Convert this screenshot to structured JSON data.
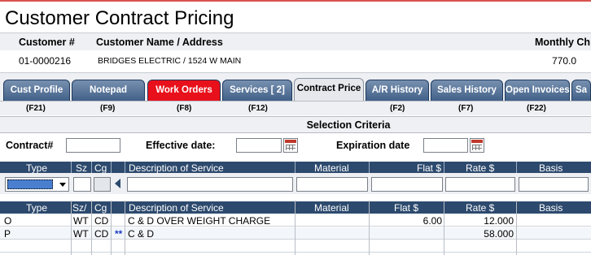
{
  "title": "Customer Contract Pricing",
  "customer": {
    "num_header": "Customer #",
    "name_header": "Customer Name / Address",
    "monthly_header": "Monthly Ch",
    "num": "01-0000216",
    "name_address": "BRIDGES ELECTRIC  /  1524 W MAIN",
    "monthly": "770.0"
  },
  "tabs": [
    {
      "label": "Cust Profile",
      "fkey": "(F21)"
    },
    {
      "label": "Notepad",
      "fkey": "(F9)"
    },
    {
      "label": "Work Orders",
      "fkey": "(F8)"
    },
    {
      "label": "Services [   2]",
      "fkey": "(F12)"
    },
    {
      "label": "Contract Price",
      "fkey": ""
    },
    {
      "label": "A/R History",
      "fkey": "(F2)"
    },
    {
      "label": "Sales History",
      "fkey": "(F7)"
    },
    {
      "label": "Open Invoices",
      "fkey": "(F22)"
    },
    {
      "label": "Sa",
      "fkey": ""
    }
  ],
  "selection": {
    "header": "Selection Criteria",
    "contract_label": "Contract#",
    "effective_label": "Effective date:",
    "expiration_label": "Expiration date"
  },
  "filter_headers": {
    "type": "Type",
    "sz": "Sz",
    "cg": "Cg",
    "description": "Description of Service",
    "material": "Material",
    "flat": "Flat $",
    "rate": "Rate $",
    "basis": "Basis"
  },
  "result_headers": {
    "type": "Type",
    "sz": "Sz/",
    "cg": "Cg",
    "description": "Description of Service",
    "material": "Material",
    "flat": "Flat $",
    "rate": "Rate $",
    "basis": "Basis"
  },
  "rows": [
    {
      "type": "O",
      "sz": "WT",
      "cg": "CD",
      "mark": "",
      "description": "C & D OVER WEIGHT CHARGE",
      "material": "",
      "flat": "6.00",
      "rate": "12.000",
      "basis": ""
    },
    {
      "type": "P",
      "sz": "WT",
      "cg": "CD",
      "mark": "**",
      "description": "C & D",
      "material": "",
      "flat": "",
      "rate": "58.000",
      "basis": ""
    }
  ]
}
